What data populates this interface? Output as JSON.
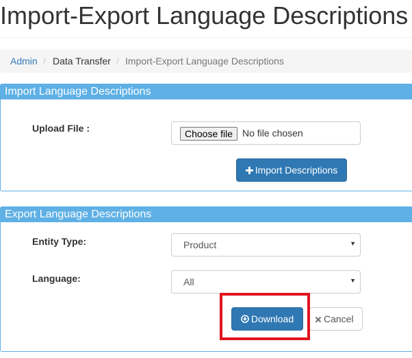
{
  "page_title": "Import-Export Language Descriptions",
  "breadcrumb": {
    "items": [
      "Admin",
      "Data Transfer",
      "Import-Export Language Descriptions"
    ],
    "separator": "/"
  },
  "import_panel": {
    "heading": "Import Language Descriptions",
    "upload_label": "Upload File :",
    "choose_file_label": "Choose file",
    "no_file_text": "No file chosen",
    "import_button_label": "Import Descriptions",
    "import_button_icon": "plus-icon"
  },
  "export_panel": {
    "heading": "Export Language Descriptions",
    "entity_type_label": "Entity Type:",
    "entity_type_value": "Product",
    "language_label": "Language:",
    "language_value": "All",
    "download_button_label": "Download",
    "download_button_icon": "download-circle-icon",
    "cancel_button_label": "Cancel",
    "cancel_button_icon": "close-icon"
  },
  "colors": {
    "panel_header": "#5eb0e5",
    "primary_button": "#2f78b3",
    "highlight_box": "#e0141e",
    "link": "#337ab7"
  }
}
